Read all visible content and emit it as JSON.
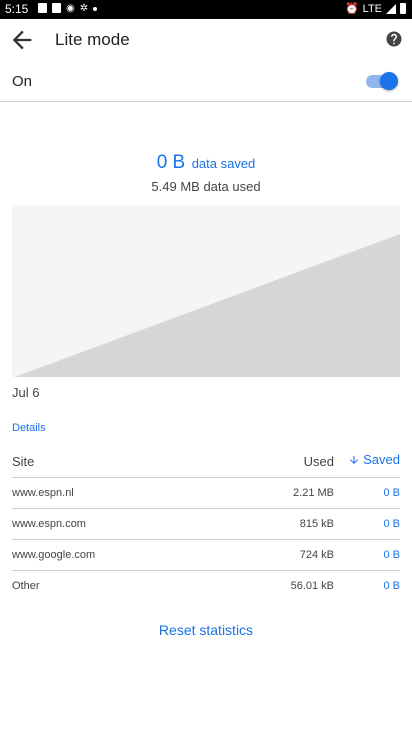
{
  "status_bar": {
    "time": "5:15",
    "left_icons": [
      "calendar-icon",
      "sim-card-icon",
      "chrome-icon",
      "settings-icon",
      "dot-icon"
    ],
    "right_text": "LTE",
    "right_icons": [
      "alarm-icon",
      "signal-icon",
      "battery-icon"
    ]
  },
  "app_bar": {
    "title": "Lite mode",
    "back_icon": "arrow-back-icon",
    "help_icon": "help-circle-icon"
  },
  "toggle": {
    "label": "On",
    "checked": true
  },
  "stats": {
    "saved_amount": "0 B",
    "saved_label": "data saved",
    "used_label": "5.49 MB data used"
  },
  "chart_data": {
    "type": "area",
    "x_start_label": "Jul 6",
    "points": [
      [
        0,
        0
      ],
      [
        1,
        1
      ]
    ],
    "fill_color": "#d6d6d6",
    "line_color": "#f5f5f5"
  },
  "details_label": "Details",
  "table": {
    "headers": {
      "site": "Site",
      "used": "Used",
      "saved": "Saved"
    },
    "rows": [
      {
        "site": "www.espn.nl",
        "used": "2.21 MB",
        "saved": "0 B"
      },
      {
        "site": "www.espn.com",
        "used": "815 kB",
        "saved": "0 B"
      },
      {
        "site": "www.google.com",
        "used": "724 kB",
        "saved": "0 B"
      },
      {
        "site": "Other",
        "used": "56.01 kB",
        "saved": "0 B"
      }
    ]
  },
  "reset_label": "Reset statistics",
  "colors": {
    "accent": "#1a73e8",
    "divider": "#cccccc",
    "chart_fill": "#d6d6d6"
  }
}
